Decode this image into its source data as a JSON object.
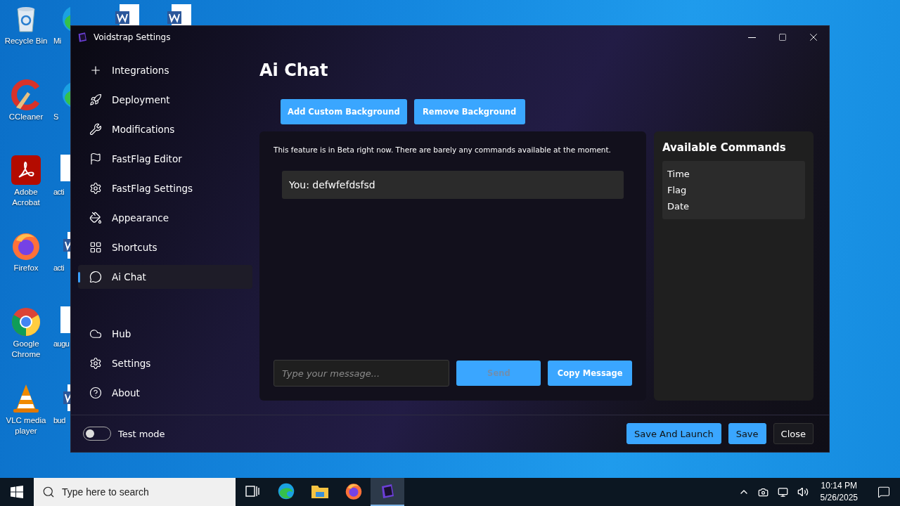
{
  "desktop": {
    "icons": [
      {
        "label": "Recycle Bin",
        "kind": "recycle"
      },
      {
        "label": "CCleaner",
        "kind": "ccleaner"
      },
      {
        "label": "Adobe Acrobat",
        "kind": "acrobat"
      },
      {
        "label": "Firefox",
        "kind": "firefox"
      },
      {
        "label": "Google Chrome",
        "kind": "chrome"
      },
      {
        "label": "VLC media player",
        "kind": "vlc"
      }
    ],
    "partial_icons": [
      {
        "label": "Mi",
        "kind": "edge"
      },
      {
        "label": "S",
        "kind": "edge"
      },
      {
        "label": "acti",
        "kind": "file"
      },
      {
        "label": "acti",
        "kind": "word"
      },
      {
        "label": "augu",
        "kind": "file"
      },
      {
        "label": "bud",
        "kind": "word"
      }
    ],
    "top_icons": [
      {
        "kind": "word"
      },
      {
        "kind": "word"
      }
    ]
  },
  "window": {
    "title": "Voidstrap Settings"
  },
  "sidebar": {
    "items": [
      {
        "label": "Integrations",
        "selected": false
      },
      {
        "label": "Deployment",
        "selected": false
      },
      {
        "label": "Modifications",
        "selected": false
      },
      {
        "label": "FastFlag Editor",
        "selected": false
      },
      {
        "label": "FastFlag Settings",
        "selected": false
      },
      {
        "label": "Appearance",
        "selected": false
      },
      {
        "label": "Shortcuts",
        "selected": false
      },
      {
        "label": "Ai Chat",
        "selected": true
      }
    ],
    "bottom_items": [
      {
        "label": "Hub",
        "selected": false
      },
      {
        "label": "Settings",
        "selected": false
      },
      {
        "label": "About",
        "selected": false
      }
    ]
  },
  "page": {
    "title": "Ai Chat",
    "buttons": [
      "Add Custom Background",
      "Remove Background"
    ],
    "notice": "This feature is in Beta right now. There are barely any commands available at the moment.",
    "messages": [
      "You: defwfefdsfsd"
    ],
    "input": {
      "placeholder": "Type your message..."
    },
    "send": {
      "label": "Send",
      "disabled": true
    },
    "copy": {
      "label": "Copy Message"
    },
    "commands": {
      "title": "Available Commands",
      "items": [
        "Time",
        "Flag",
        "Date"
      ]
    }
  },
  "footer": {
    "toggle": {
      "label": "Test mode",
      "on": false
    },
    "buttons": [
      {
        "label": "Save And Launch",
        "kind": "primary"
      },
      {
        "label": "Save",
        "kind": "primary"
      },
      {
        "label": "Close",
        "kind": "secondary"
      }
    ]
  },
  "taskbar": {
    "search": {
      "placeholder": "Type here to search"
    },
    "apps": [
      {
        "kind": "taskview",
        "selected": false
      },
      {
        "kind": "edge",
        "selected": false
      },
      {
        "kind": "explorer",
        "selected": false
      },
      {
        "kind": "firefox",
        "selected": false
      },
      {
        "kind": "voidstrap",
        "selected": true
      }
    ],
    "time": "10:14 PM",
    "date": "5/26/2025"
  }
}
